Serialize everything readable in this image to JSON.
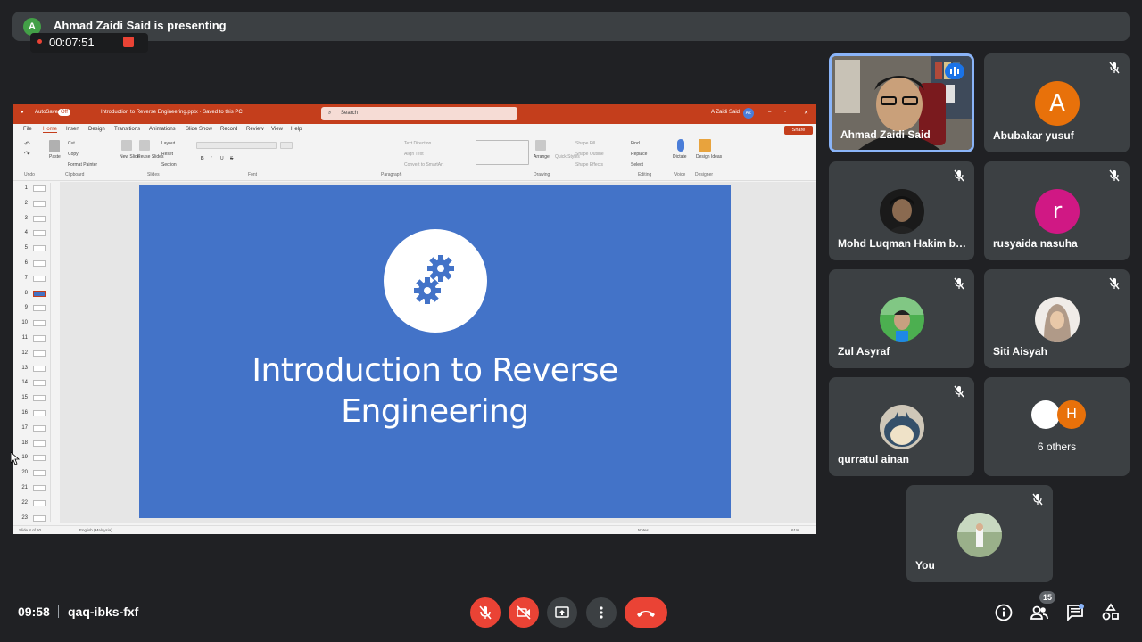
{
  "presenter": {
    "avatar_letter": "A",
    "banner_text": "Ahmad Zaidi Said is presenting",
    "recording_time": "00:07:51"
  },
  "powerpoint": {
    "autosave_label": "AutoSave",
    "autosave_state": "Off",
    "doc_title": "Introduction to Reverse Engineering.pptx · Saved to this PC",
    "search_placeholder": "Search",
    "user_name": "A Zaidi Said",
    "user_initials": "AZ",
    "menu_tabs": [
      "File",
      "Home",
      "Insert",
      "Design",
      "Transitions",
      "Animations",
      "Slide Show",
      "Record",
      "Review",
      "View",
      "Help"
    ],
    "share_label": "Share",
    "ribbon": {
      "undo": "Undo",
      "paste": "Paste",
      "cut": "Cut",
      "copy": "Copy",
      "format_painter": "Format Painter",
      "clipboard": "Clipboard",
      "new_slide": "New Slide",
      "reuse_slides": "Reuse Slides",
      "layout": "Layout",
      "reset": "Reset",
      "section": "Section",
      "slides": "Slides",
      "font": "Font",
      "text_direction": "Text Direction",
      "align_text": "Align Text",
      "convert_smartart": "Convert to SmartArt",
      "paragraph": "Paragraph",
      "arrange": "Arrange",
      "quick_styles": "Quick Styles",
      "shape_fill": "Shape Fill",
      "shape_outline": "Shape Outline",
      "shape_effects": "Shape Effects",
      "drawing": "Drawing",
      "find": "Find",
      "replace": "Replace",
      "select": "Select",
      "editing": "Editing",
      "dictate": "Dictate",
      "voice": "Voice",
      "design_ideas": "Design Ideas",
      "designer": "Designer"
    },
    "thumbnail_numbers": [
      "1",
      "2",
      "3",
      "4",
      "5",
      "6",
      "7",
      "8",
      "9",
      "10",
      "11",
      "12",
      "13",
      "14",
      "15",
      "16",
      "17",
      "18",
      "19",
      "20",
      "21",
      "22",
      "23"
    ],
    "selected_slide": 8,
    "slide_title_line1": "Introduction to Reverse",
    "slide_title_line2": "Engineering",
    "status_slide": "Slide 8 of 60",
    "status_language": "English (Malaysia)",
    "status_notes": "Notes",
    "status_zoom": "61%"
  },
  "participants": [
    {
      "name": "Ahmad Zaidi Said",
      "speaking": true
    },
    {
      "name": "Abubakar yusuf",
      "initial": "A",
      "color": "#e8710a",
      "muted": true
    },
    {
      "name": "Mohd Luqman Hakim bi...",
      "muted": true
    },
    {
      "name": "rusyaida nasuha",
      "initial": "r",
      "color": "#d01884",
      "muted": true
    },
    {
      "name": "Zul Asyraf",
      "muted": true
    },
    {
      "name": "Siti Aisyah",
      "muted": true
    },
    {
      "name": "qurratul ainan",
      "muted": true
    },
    {
      "name": "6 others",
      "others_initial": "H",
      "others_color": "#e8710a"
    },
    {
      "name": "You",
      "muted": true
    }
  ],
  "bottom_bar": {
    "clock": "09:58",
    "meeting_code": "qaq-ibks-fxf",
    "people_count": "15"
  },
  "colors": {
    "background": "#202124",
    "tile": "#3c4043",
    "danger": "#ea4335",
    "ppt_accent": "#c43e1c",
    "slide_blue": "#4373c8",
    "active_border": "#8ab4f8"
  }
}
